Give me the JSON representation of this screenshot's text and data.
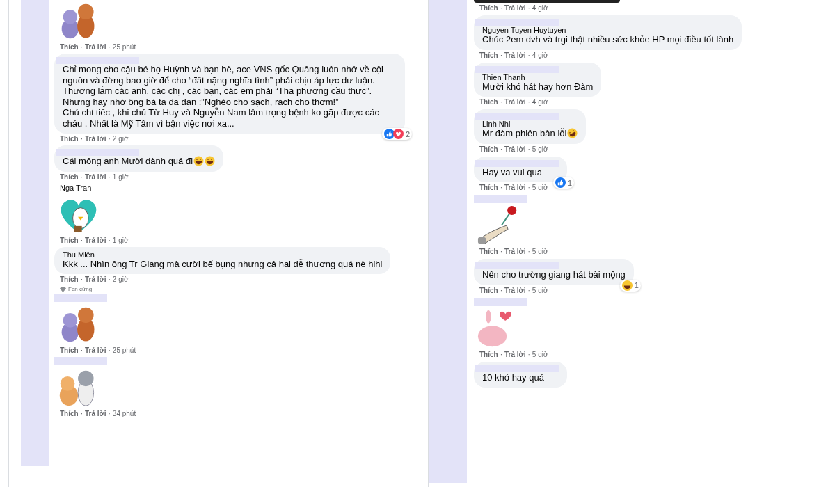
{
  "separator": "·",
  "panels": [
    {
      "comments": [
        {
          "kind": "sticker",
          "sticker": {
            "kind": "cat-dog"
          },
          "actions": [
            "Thích",
            "Trả lời"
          ],
          "time": "25 phút"
        },
        {
          "kind": "text",
          "name_redacted": true,
          "text": "Chỉ mong cho cậu bé họ Huỳnh và bạn bè, ace VNS gốc Quảng luôn nhớ về cội nguồn và đừng bao giờ để cho “đất nặng nghĩa tình” phải chịu áp lực dư luận. Thương lắm các anh, các chị , các bạn, các em phải “Tha phương cầu thực”. Nhưng hãy nhớ ông bà ta đã dặn :”Nghèo cho sạch, rách cho thơm!”\nChú chỉ tiếc , khi chú Từ Huy và Nguyễn Nam lâm trọng bệnh ko gặp được các cháu , Nhất là Mỹ Tâm vì bận việc nơi xa...",
          "reactions": [
            {
              "kind": "like"
            },
            {
              "kind": "love"
            }
          ],
          "reaction_count": "2",
          "actions": [
            "Thích",
            "Trả lời"
          ],
          "time": "2 giờ"
        },
        {
          "kind": "text",
          "name_redacted": true,
          "text": "Cái mông anh Mười dành quá đi",
          "emojis": [
            {
              "kind": "laugh"
            },
            {
              "kind": "laugh"
            }
          ],
          "actions": [
            "Thích",
            "Trả lời"
          ],
          "time": "1 giờ"
        },
        {
          "kind": "sticker",
          "name": "Nga Tran",
          "sticker": {
            "kind": "duck-heart"
          },
          "actions": [
            "Thích",
            "Trả lời"
          ],
          "time": "1 giờ"
        },
        {
          "kind": "text",
          "name": "Thu Miên",
          "text": "Kkk ... Nhìn ông Tr Giang mà cười bể bụng nhưng cả hai dễ thương quá nè hihi",
          "actions": [
            "Thích",
            "Trả lời"
          ],
          "time": "2 giờ"
        },
        {
          "kind": "sticker",
          "badge": "Fan cứng",
          "name_redacted": true,
          "sticker": {
            "kind": "cat-dog"
          },
          "actions": [
            "Thích",
            "Trả lời"
          ],
          "time": "25 phút"
        },
        {
          "kind": "sticker",
          "name_redacted": true,
          "sticker": {
            "kind": "dogs"
          },
          "actions": [
            "Thích",
            "Trả lời"
          ],
          "time": "34 phút"
        }
      ]
    },
    {
      "comments": [
        {
          "kind": "image",
          "actions": [
            "Thích",
            "Trả lời"
          ],
          "time": "4 giờ"
        },
        {
          "kind": "text",
          "name_redacted": true,
          "name": "Nguyen Tuyen Huytuyen",
          "text": "Chúc 2em dvh và trgi thật nhiều sức khỏe HP mọi điều tốt lành",
          "actions": [
            "Thích",
            "Trả lời"
          ],
          "time": "4 giờ"
        },
        {
          "kind": "text",
          "name_redacted": true,
          "name": "Thien Thanh",
          "text": "Mười khó hát hay hơn Đàm",
          "actions": [
            "Thích",
            "Trả lời"
          ],
          "time": "4 giờ"
        },
        {
          "kind": "text",
          "name_redacted": true,
          "name": "Linh Nhi",
          "text": "Mr đàm phiên bản lỗi",
          "emojis": [
            {
              "kind": "rofl"
            }
          ],
          "actions": [
            "Thích",
            "Trả lời"
          ],
          "time": "5 giờ"
        },
        {
          "kind": "text",
          "name_redacted": true,
          "text": "Hay va vui qua",
          "reactions": [
            {
              "kind": "like"
            }
          ],
          "reaction_count": "1",
          "actions": [
            "Thích",
            "Trả lời"
          ],
          "time": "5 giờ"
        },
        {
          "kind": "sticker",
          "name_redacted": true,
          "sticker": {
            "kind": "rose-hand"
          },
          "actions": [
            "Thích",
            "Trả lời"
          ],
          "time": "5 giờ"
        },
        {
          "kind": "text",
          "name_redacted": true,
          "text": "Nên cho trường giang hát bài mộng",
          "reactions": [
            {
              "kind": "haha"
            }
          ],
          "reaction_count": "1",
          "actions": [
            "Thích",
            "Trả lời"
          ],
          "time": "5 giờ"
        },
        {
          "kind": "sticker",
          "name_redacted": true,
          "sticker": {
            "kind": "bird"
          },
          "actions": [
            "Thích",
            "Trả lời"
          ],
          "time": "5 giờ"
        },
        {
          "kind": "text",
          "name_redacted": true,
          "text": "10 khó hay quá"
        }
      ]
    }
  ]
}
